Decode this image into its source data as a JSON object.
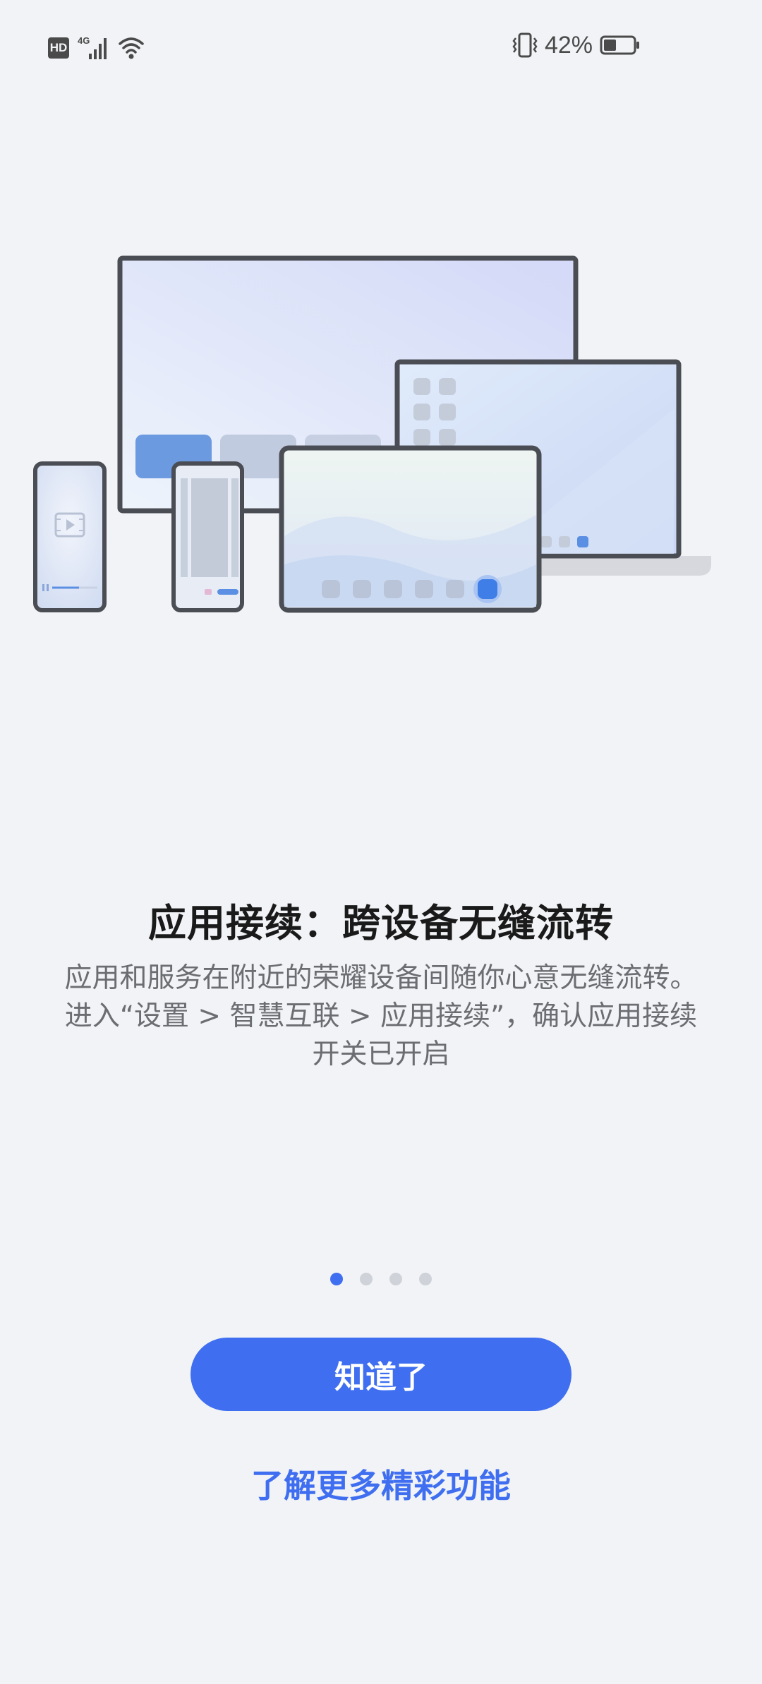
{
  "status_bar": {
    "hd_label": "HD",
    "network_label": "4G",
    "battery_percent": "42%",
    "battery_level": 0.42,
    "icons": [
      "hd-icon",
      "signal-icon",
      "wifi-icon",
      "vibrate-icon",
      "battery-icon"
    ]
  },
  "illustration": {
    "name": "multi-device-illustration"
  },
  "content": {
    "title": "应用接续：跨设备无缝流转",
    "description_lines": [
      "应用和服务在附近的荣耀设备间随你心意无缝流转。",
      "进入“设置 > 智慧互联 > 应用接续”，确认应用接续",
      "开关已开启"
    ]
  },
  "pager": {
    "total": 4,
    "current": 1
  },
  "actions": {
    "primary_label": "知道了",
    "secondary_label": "了解更多精彩功能"
  },
  "colors": {
    "accent": "#3f6ff0",
    "background": "#f1f3f6",
    "title_text": "#1a1a1a",
    "body_text": "#6b6d72",
    "dot_inactive": "#cfd2d8"
  }
}
